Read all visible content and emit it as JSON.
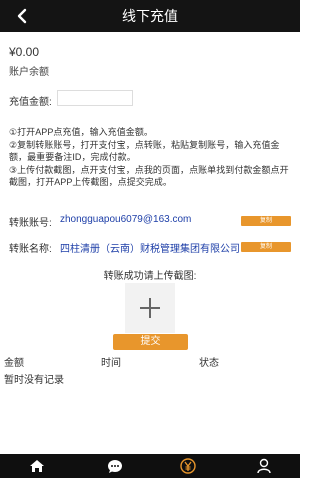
{
  "header": {
    "title": "线下充值",
    "back_icon": "chevron-left-icon"
  },
  "balance": {
    "amount": "¥0.00",
    "label": "账户余额"
  },
  "recharge": {
    "label": "充值金额:",
    "value": "",
    "placeholder": ""
  },
  "instructions": [
    "①打开APP点充值，输入充值金额。",
    "②复制转账账号，打开支付宝，点转账，粘贴复制账号，输入充值金额，最重要备注ID，完成付款。",
    "③上传付款截图，点开支付宝，点我的页面，点账单找到付款金额点开截图，打开APP上传截图，点提交完成。"
  ],
  "transfer_account": {
    "label": "转账账号:",
    "value": "zhongguapou6079@163.com",
    "copy_label": "复制"
  },
  "transfer_name": {
    "label": "转账名称:",
    "value": "四柱清册（云南）财税管理集团有限公司",
    "copy_label": "复制"
  },
  "upload": {
    "title": "转账成功请上传截图:",
    "icon": "plus-icon"
  },
  "submit_label": "提交",
  "records": {
    "columns": [
      "金额",
      "时间",
      "状态"
    ],
    "empty_text": "暂时没有记录"
  },
  "tabbar": {
    "icons": [
      "home-icon",
      "chat-icon",
      "yen-coin-icon",
      "user-icon"
    ]
  },
  "colors": {
    "header_bg": "#141414",
    "accent": "#e8962c",
    "link": "#1e3fa8",
    "tabbar_bg": "#0f0f0f"
  }
}
